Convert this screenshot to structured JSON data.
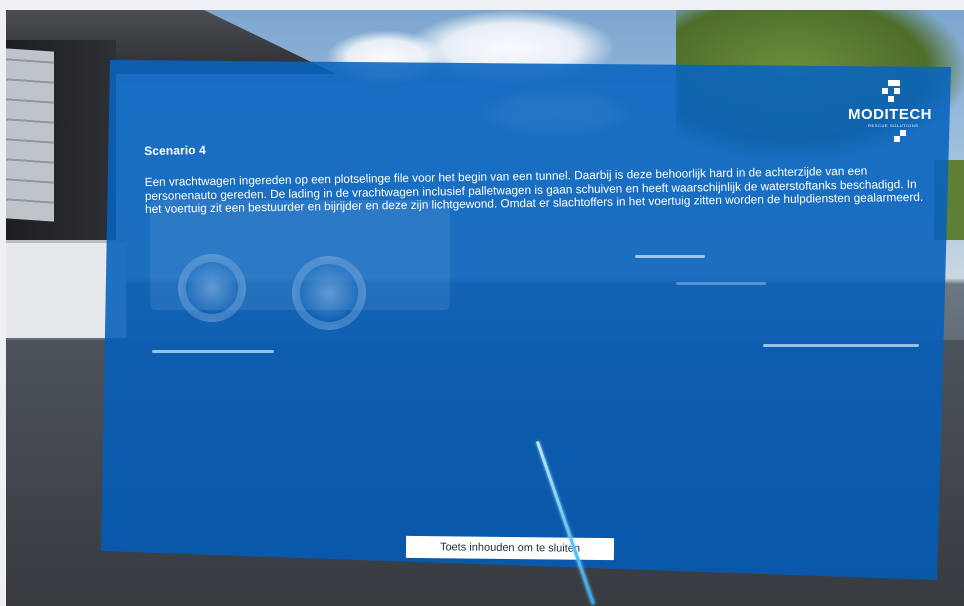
{
  "scene": {
    "panel_color": "#0662be",
    "laser_color": "#2aa8f0"
  },
  "logo": {
    "brand": "MODITECH",
    "tagline": "RESCUE SOLUTIONS"
  },
  "scenario": {
    "title": "Scenario 4",
    "body": "Een vrachtwagen ingereden op een plotselinge file voor het begin van een tunnel. Daarbij is deze behoorlijk hard in de achterzijde van een personenauto gereden. De lading in de vrachtwagen inclusief palletwagen is gaan schuiven en heeft waarschijnlijk de waterstoftanks beschadigd. In het voertuig zit een bestuurder en bijrijder en deze zijn lichtgewond. Omdat er slachtoffers in het voertuig zitten worden de hulpdiensten gealarmeerd."
  },
  "controls": {
    "close_hold_label": "Toets inhouden om te sluiten"
  }
}
